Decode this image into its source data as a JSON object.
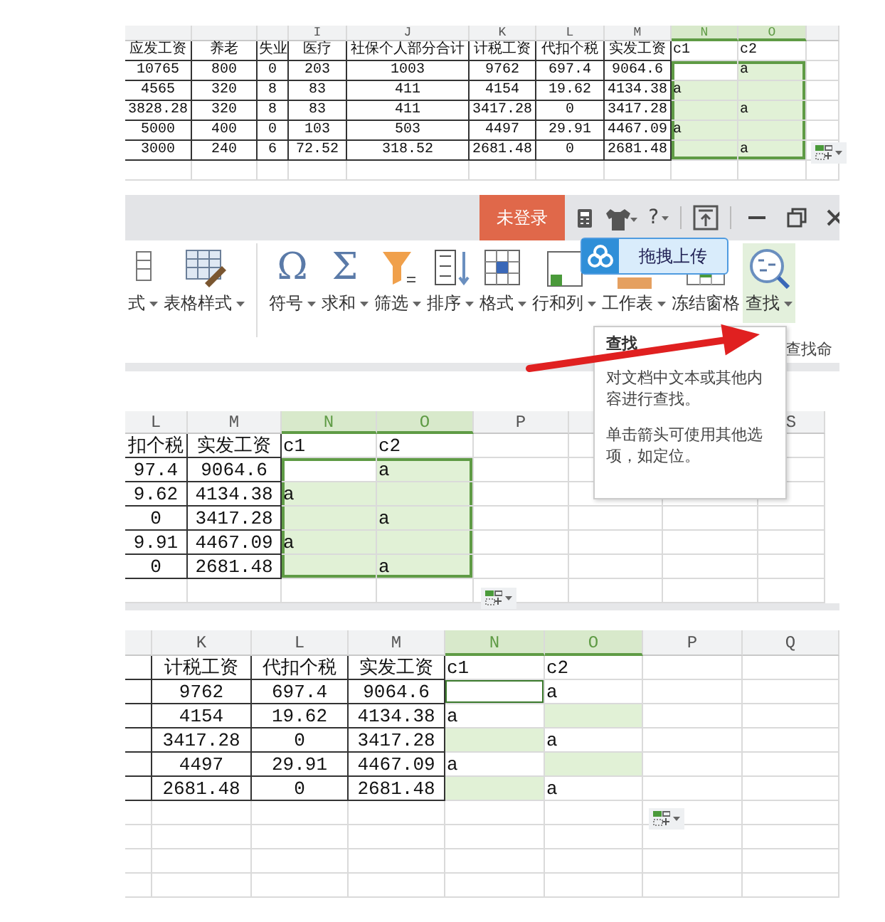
{
  "sheets": [
    {
      "range_outline": true,
      "columns": [
        {
          "selected": false
        },
        {
          "selected": false
        },
        {
          "selected": false
        },
        {
          "letter": "I",
          "selected": false
        },
        {
          "letter": "J",
          "selected": false
        },
        {
          "letter": "K",
          "selected": false
        },
        {
          "letter": "L",
          "selected": false
        },
        {
          "letter": "M",
          "selected": false
        },
        {
          "letter": "N",
          "selected": true
        },
        {
          "letter": "O",
          "selected": true
        },
        {
          "selected": false
        }
      ],
      "rows": [
        [
          "应发工资",
          "养老",
          "失业",
          "医疗",
          "社保个人部分合计",
          "计税工资",
          "代扣个税",
          "实发工资",
          {
            "text": "c1",
            "highlighted": false
          },
          {
            "text": "c2",
            "highlighted": false
          }
        ],
        [
          "10765",
          "800",
          "0",
          "203",
          "1003",
          "9762",
          "697.4",
          "9064.6",
          {
            "highlighted": false
          },
          {
            "text": "a",
            "highlighted": true
          }
        ],
        [
          "4565",
          "320",
          "8",
          "83",
          "411",
          "4154",
          "19.62",
          "4134.38",
          {
            "text": "a",
            "highlighted": true
          },
          {
            "highlighted": true
          }
        ],
        [
          "3828.28",
          "320",
          "8",
          "83",
          "411",
          "3417.28",
          "0",
          "3417.28",
          {
            "highlighted": true
          },
          {
            "text": "a",
            "highlighted": true
          }
        ],
        [
          "5000",
          "400",
          "0",
          "103",
          "503",
          "4497",
          "29.91",
          "4467.09",
          {
            "text": "a",
            "highlighted": true
          },
          {
            "highlighted": true
          }
        ],
        [
          "3000",
          "240",
          "6",
          "72.52",
          "318.52",
          "2681.48",
          "0",
          "2681.48",
          {
            "highlighted": true
          },
          {
            "text": "a",
            "highlighted": true
          }
        ]
      ]
    },
    {
      "range_outline": true,
      "columns": [
        {
          "letter": "L",
          "selected": false
        },
        {
          "letter": "M",
          "selected": false
        },
        {
          "letter": "N",
          "selected": true
        },
        {
          "letter": "O",
          "selected": true
        },
        {
          "letter": "P",
          "selected": false
        },
        {},
        {},
        {
          "letter": "S",
          "selected": false
        }
      ],
      "rows": [
        [
          "扣个税",
          "实发工资",
          {
            "text": "c1",
            "highlighted": false
          },
          {
            "text": "c2",
            "highlighted": false
          }
        ],
        [
          "97.4",
          "9064.6",
          {
            "highlighted": false
          },
          {
            "text": "a",
            "highlighted": true
          }
        ],
        [
          "9.62",
          "4134.38",
          {
            "text": "a",
            "highlighted": true
          },
          {
            "highlighted": true
          }
        ],
        [
          "0",
          "3417.28",
          {
            "highlighted": true
          },
          {
            "text": "a",
            "highlighted": true
          }
        ],
        [
          "9.91",
          "4467.09",
          {
            "text": "a",
            "highlighted": true
          },
          {
            "highlighted": true
          }
        ],
        [
          "0",
          "2681.48",
          {
            "highlighted": true
          },
          {
            "text": "a",
            "highlighted": true
          }
        ]
      ]
    },
    {
      "range_outline": false,
      "columns": [
        {
          "selected": false
        },
        {
          "letter": "K",
          "selected": false
        },
        {
          "letter": "L",
          "selected": false
        },
        {
          "letter": "M",
          "selected": false
        },
        {
          "letter": "N",
          "selected": true
        },
        {
          "letter": "O",
          "selected": true
        },
        {
          "letter": "P",
          "selected": false
        },
        {
          "letter": "Q",
          "selected": false
        }
      ],
      "rows": [
        [
          null,
          "计税工资",
          "代扣个税",
          "实发工资",
          {
            "text": "c1",
            "highlighted": false
          },
          {
            "text": "c2",
            "highlighted": false
          }
        ],
        [
          null,
          "9762",
          "697.4",
          "9064.6",
          {
            "highlighted": false,
            "active": true
          },
          {
            "text": "a",
            "highlighted": false
          }
        ],
        [
          null,
          "4154",
          "19.62",
          "4134.38",
          {
            "text": "a",
            "highlighted": false
          },
          {
            "highlighted": true
          }
        ],
        [
          null,
          "3417.28",
          "0",
          "3417.28",
          {
            "highlighted": true
          },
          {
            "text": "a",
            "highlighted": false
          }
        ],
        [
          null,
          "4497",
          "29.91",
          "4467.09",
          {
            "text": "a",
            "highlighted": false
          },
          {
            "highlighted": true
          }
        ],
        [
          null,
          "2681.48",
          "0",
          "2681.48",
          {
            "highlighted": true
          },
          {
            "text": "a",
            "highlighted": false
          }
        ]
      ]
    }
  ],
  "title_bar": {
    "login_button": "未登录",
    "help": "?"
  },
  "upload_badge": "拖拽上传",
  "ribbon": [
    {
      "label": "式",
      "dropdown": true,
      "selected": false
    },
    {
      "label": "表格样式",
      "dropdown": true,
      "selected": false
    },
    {
      "label": "符号",
      "glyph": "Ω",
      "dropdown": true,
      "selected": false
    },
    {
      "label": "求和",
      "glyph": "Σ",
      "dropdown": true,
      "selected": false
    },
    {
      "label": "筛选",
      "dropdown": true,
      "selected": false
    },
    {
      "label": "排序",
      "dropdown": true,
      "selected": false
    },
    {
      "label": "格式",
      "dropdown": true,
      "selected": false
    },
    {
      "label": "行和列",
      "dropdown": true,
      "selected": false
    },
    {
      "label": "工作表",
      "dropdown": true,
      "selected": false
    },
    {
      "label": "冻结窗格",
      "dropdown": false,
      "selected": false
    },
    {
      "label": "查找",
      "dropdown": true,
      "selected": true
    }
  ],
  "side_text": "查找命",
  "tooltip": {
    "title": "查找",
    "paragraphs": [
      "对文档中文本或其他内容进行查找。",
      "单击箭头可使用其他选项，如定位。"
    ]
  }
}
